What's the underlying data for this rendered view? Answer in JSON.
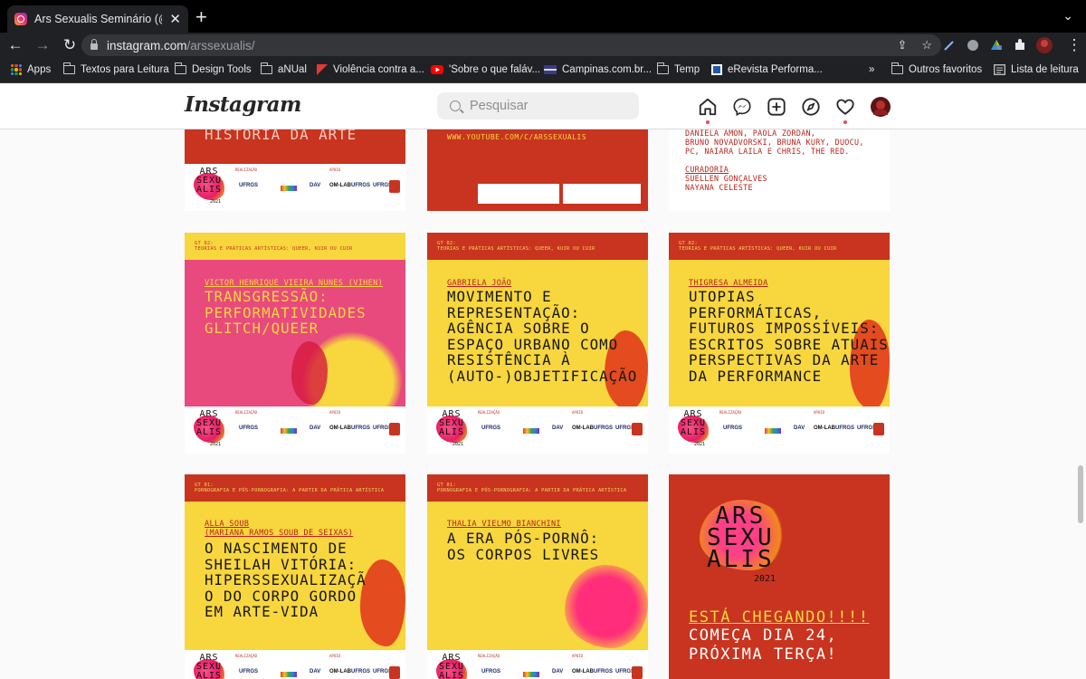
{
  "browser": {
    "tab_title": "Ars Sexualis Seminário (@arss",
    "url_host": "instagram.com",
    "url_path": "/arssexualis/",
    "bookmarks": [
      "Apps",
      "Textos para Leitura",
      "Design Tools",
      "aNUal",
      "Violência contra a...",
      "'Sobre o que faláv...",
      "Campinas.com.br...",
      "Temp",
      "eRevista Performa...",
      "»",
      "Outros favoritos",
      "Lista de leitura"
    ]
  },
  "header": {
    "logo": "Instagram",
    "search_placeholder": "Pesquisar"
  },
  "colors": {
    "red": "#c8341f",
    "yellow": "#f8d63e",
    "pink": "#e84a7e",
    "ig_notification": "#ed4956"
  },
  "posts": {
    "p1": {
      "title_tail": "HISTÓRIA DA ARTE"
    },
    "p2": {
      "link": "WWW.YOUTUBE.COM/C/ARSSEXUALIS"
    },
    "p3": {
      "names": [
        "DANIELA AMON, PAOLA ZORDAN,",
        "BRUNO NOVADVORSKI, BRUNA KURY, DUOCU,",
        "PC, NAIARA LAILA E CHRIS, THE RED."
      ],
      "curadoria_label": "CURADORIA",
      "curators": [
        "SUELLEN GONÇALVES",
        "NAYANA CELESTE"
      ]
    },
    "p4": {
      "gt": "GT 02:\nTEORIAS E PRÁTICAS ARTÍSTICAS: QUEER, KUIR OU CUIR",
      "author": "VICTOR HENRIQUE VIEIRA NUNES (VIHEN)",
      "title": "TRANSGRESSÃO:\nPERFORMATIVIDADES\nGLITCH/QUEER"
    },
    "p5": {
      "gt": "GT 02:\nTEORIAS E PRÁTICAS ARTÍSTICAS: QUEER, KUIR OU CUIR",
      "author": "GABRIELA JOÃO",
      "title": "MOVIMENTO E\nREPRESENTAÇÃO:\nAGÊNCIA SOBRE O\nESPAÇO URBANO COMO\nRESISTÊNCIA À\n(AUTO-)OBJETIFICAÇÃO"
    },
    "p6": {
      "gt": "GT 02:\nTEORIAS E PRÁTICAS ARTÍSTICAS: QUEER, KUIR OU CUIR",
      "author": "THIGRESA ALMEIDA",
      "title": "UTOPIAS\nPERFORMÁTICAS,\nFUTUROS IMPOSSÍVEIS:\nESCRITOS SOBRE ATUAIS\nPERSPECTIVAS DA ARTE\nDA PERFORMANCE"
    },
    "p7": {
      "gt": "GT 01:\nPORNOGRAFIA E PÓS-PORNOGRAFIA: A PARTIR DA PRÁTICA ARTÍSTICA",
      "author": "ALLA SOUB\n(MARIANA RAMOS SOUB DE SEIXAS)",
      "title": "O NASCIMENTO DE\nSHEILAH VITÓRIA:\nHIPERSSEXUALIZAÇÃ\nO DO CORPO GORDO\nEM ARTE-VIDA"
    },
    "p8": {
      "gt": "GT 01:\nPORNOGRAFIA E PÓS-PORNOGRAFIA: A PARTIR DA PRÁTICA ARTÍSTICA",
      "author": "THALIA VIELMO BIANCHINI",
      "title": "A ERA PÓS-PORNÔ:\nOS CORPOS LIVRES"
    },
    "p9": {
      "logo": "ARS\nSEXU\nALIS",
      "year": "2021",
      "headline": "ESTÁ CHEGANDO!!!!",
      "sub": "COMEÇA DIA 24,\nPRÓXIMA TERÇA!"
    }
  },
  "strip": {
    "logo": "ARS\nSEXU\nALIS",
    "year": "2021",
    "realizacao": "REALIZAÇÃO",
    "apoio": "APOIO",
    "partners": [
      "UFRGS",
      "OM-LAB",
      "DAV"
    ]
  }
}
